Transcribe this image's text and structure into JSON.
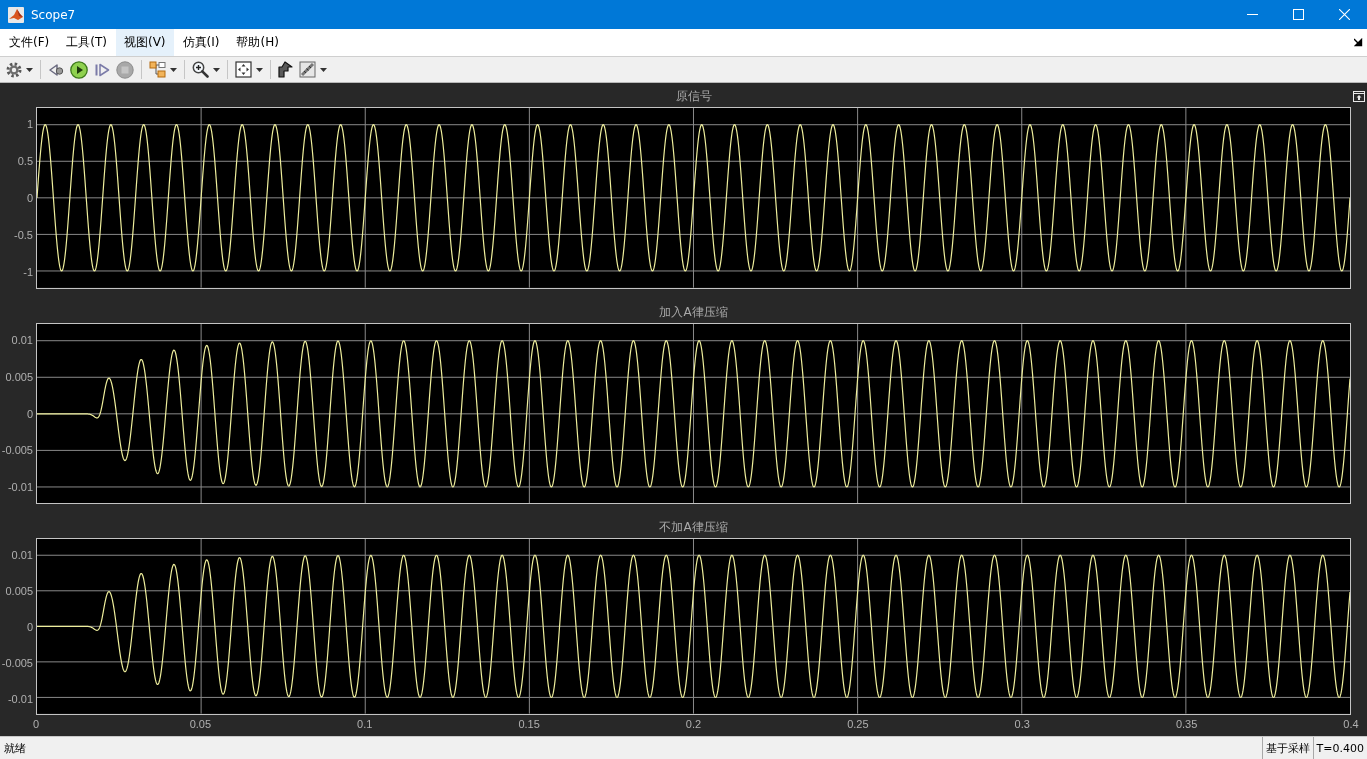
{
  "window": {
    "title": "Scope7"
  },
  "menu": [
    {
      "label": "文件(F)",
      "selected": false
    },
    {
      "label": "工具(T)",
      "selected": false
    },
    {
      "label": "视图(V)",
      "selected": true
    },
    {
      "label": "仿真(I)",
      "selected": false
    },
    {
      "label": "帮助(H)",
      "selected": false
    }
  ],
  "toolbar": {
    "stop": {
      "disabled": true
    }
  },
  "plots": [
    {
      "title": "原信号",
      "kind": "sine",
      "y_tick_labels": [
        "1",
        "0.5",
        "0",
        "-0.5",
        "-1"
      ]
    },
    {
      "title": "加入A律压缩",
      "kind": "onset",
      "y_tick_labels": [
        "0.01",
        "0.005",
        "0",
        "-0.005",
        "-0.01"
      ]
    },
    {
      "title": "不加A律压缩",
      "kind": "onset",
      "y_tick_labels": [
        "0.01",
        "0.005",
        "0",
        "-0.005",
        "-0.01"
      ]
    }
  ],
  "time_axis": {
    "tick_labels": [
      "0",
      "0.05",
      "0.1",
      "0.15",
      "0.2",
      "0.25",
      "0.3",
      "0.35",
      "0.4"
    ]
  },
  "status_bar": {
    "message": "就绪",
    "sample_mode": "基于采样",
    "time": "T=0.400"
  }
}
